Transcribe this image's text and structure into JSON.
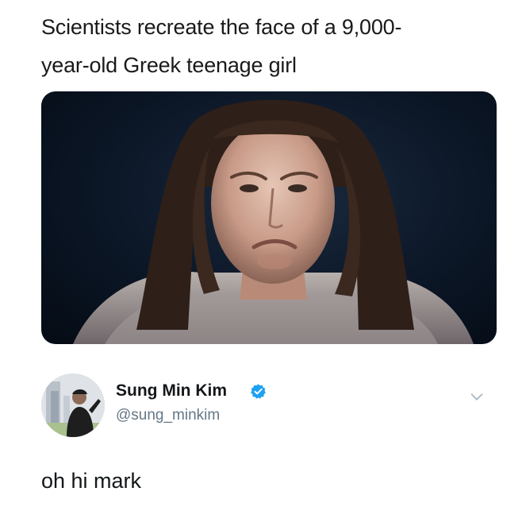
{
  "headline": {
    "line1": "Scientists recreate the face of a 9,000-",
    "line2": "year-old Greek teenage girl"
  },
  "tweet": {
    "display_name": "Sung Min Kim",
    "handle": "@sung_minkim",
    "verified": true,
    "text": "oh hi mark"
  },
  "icons": {
    "verified": "verified-badge-icon",
    "menu": "chevron-down-icon"
  },
  "colors": {
    "verified_blue": "#1da1f2",
    "handle_gray": "#657786",
    "photo_background": "#0b1626"
  }
}
